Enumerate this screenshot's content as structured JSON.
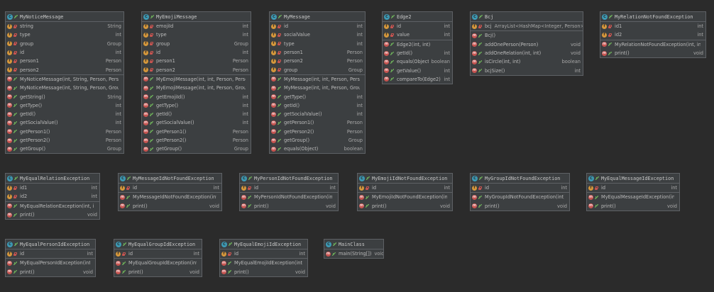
{
  "classes": [
    {
      "id": "MyNoticeMessage",
      "name": "MyNoticeMessage",
      "fields": [
        {
          "name": "string",
          "type": "String"
        },
        {
          "name": "type",
          "type": "int"
        },
        {
          "name": "group",
          "type": "Group"
        },
        {
          "name": "id",
          "type": "int"
        },
        {
          "name": "person1",
          "type": "Person"
        },
        {
          "name": "person2",
          "type": "Person"
        }
      ],
      "methods": [
        {
          "name": "MyNoticeMessage(int, String, Person, Person)",
          "type": ""
        },
        {
          "name": "MyNoticeMessage(int, String, Person, Group)",
          "type": ""
        },
        {
          "name": "getString()",
          "type": "String"
        },
        {
          "name": "getType()",
          "type": "int"
        },
        {
          "name": "getId()",
          "type": "int"
        },
        {
          "name": "getSocialValue()",
          "type": "int"
        },
        {
          "name": "getPerson1()",
          "type": "Person"
        },
        {
          "name": "getPerson2()",
          "type": "Person"
        },
        {
          "name": "getGroup()",
          "type": "Group"
        }
      ]
    },
    {
      "id": "MyEmojiMessage",
      "name": "MyEmojiMessage",
      "fields": [
        {
          "name": "emojiId",
          "type": "int"
        },
        {
          "name": "type",
          "type": "int"
        },
        {
          "name": "group",
          "type": "Group"
        },
        {
          "name": "id",
          "type": "int"
        },
        {
          "name": "person1",
          "type": "Person"
        },
        {
          "name": "person2",
          "type": "Person"
        }
      ],
      "methods": [
        {
          "name": "MyEmojiMessage(int, int, Person, Person)",
          "type": ""
        },
        {
          "name": "MyEmojiMessage(int, int, Person, Group)",
          "type": ""
        },
        {
          "name": "getEmojiId()",
          "type": "int"
        },
        {
          "name": "getType()",
          "type": "int"
        },
        {
          "name": "getId()",
          "type": "int"
        },
        {
          "name": "getSocialValue()",
          "type": "int"
        },
        {
          "name": "getPerson1()",
          "type": "Person"
        },
        {
          "name": "getPerson2()",
          "type": "Person"
        },
        {
          "name": "getGroup()",
          "type": "Group"
        }
      ]
    },
    {
      "id": "MyMessage",
      "name": "MyMessage",
      "fields": [
        {
          "name": "id",
          "type": "int"
        },
        {
          "name": "socialValue",
          "type": "int"
        },
        {
          "name": "type",
          "type": "int"
        },
        {
          "name": "person1",
          "type": "Person"
        },
        {
          "name": "person2",
          "type": "Person"
        },
        {
          "name": "group",
          "type": "Group"
        }
      ],
      "methods": [
        {
          "name": "MyMessage(int, int, Person, Person)",
          "type": ""
        },
        {
          "name": "MyMessage(int, int, Person, Group)",
          "type": ""
        },
        {
          "name": "getType()",
          "type": "int"
        },
        {
          "name": "getId()",
          "type": "int"
        },
        {
          "name": "getSocialValue()",
          "type": "int"
        },
        {
          "name": "getPerson1()",
          "type": "Person"
        },
        {
          "name": "getPerson2()",
          "type": "Person"
        },
        {
          "name": "getGroup()",
          "type": "Group"
        },
        {
          "name": "equals(Object)",
          "type": "boolean"
        }
      ]
    },
    {
      "id": "Edge2",
      "name": "Edge2",
      "fields": [
        {
          "name": "id",
          "type": "int"
        },
        {
          "name": "value",
          "type": "int"
        }
      ],
      "methods": [
        {
          "name": "Edge2(int, int)",
          "type": ""
        },
        {
          "name": "getId()",
          "type": "int"
        },
        {
          "name": "equals(Object)",
          "type": "boolean"
        },
        {
          "name": "getValue()",
          "type": "int"
        },
        {
          "name": "compareTo(Edge2)",
          "type": "int"
        }
      ]
    },
    {
      "id": "Bcj",
      "name": "Bcj",
      "fields": [
        {
          "name": "bcj",
          "type": "ArrayList<HashMap<Integer, Person>>",
          "inline": true
        }
      ],
      "methods": [
        {
          "name": "Bcj()",
          "type": ""
        },
        {
          "name": "addOnePerson(Person)",
          "type": "void"
        },
        {
          "name": "addOneRelation(int, int)",
          "type": "void"
        },
        {
          "name": "isCircle(int, int)",
          "type": "boolean"
        },
        {
          "name": "bcjSize()",
          "type": "int"
        }
      ]
    },
    {
      "id": "MyRelationNotFoundException",
      "name": "MyRelationNotFoundException",
      "fields": [
        {
          "name": "id1",
          "type": "int"
        },
        {
          "name": "id2",
          "type": "int"
        }
      ],
      "methods": [
        {
          "name": "MyRelationNotFoundException(int, int)",
          "type": ""
        },
        {
          "name": "print()",
          "type": "void"
        }
      ]
    },
    {
      "id": "MyEqualRelationException",
      "name": "MyEqualRelationException",
      "fields": [
        {
          "name": "id1",
          "type": "int"
        },
        {
          "name": "id2",
          "type": "int"
        }
      ],
      "methods": [
        {
          "name": "MyEqualRelationException(int, int)",
          "type": ""
        },
        {
          "name": "print()",
          "type": "void"
        }
      ]
    },
    {
      "id": "MyMessageIdNotFoundException",
      "name": "MyMessageIdNotFoundException",
      "fields": [
        {
          "name": "id",
          "type": "int"
        }
      ],
      "methods": [
        {
          "name": "MyMessageIdNotFoundException(int)",
          "type": ""
        },
        {
          "name": "print()",
          "type": "void"
        }
      ]
    },
    {
      "id": "MyPersonIdNotFoundException",
      "name": "MyPersonIdNotFoundException",
      "fields": [
        {
          "name": "id",
          "type": "int"
        }
      ],
      "methods": [
        {
          "name": "MyPersonIdNotFoundException(int)",
          "type": ""
        },
        {
          "name": "print()",
          "type": "void"
        }
      ]
    },
    {
      "id": "MyEmojiIdNotFoundException",
      "name": "MyEmojiIdNotFoundException",
      "fields": [
        {
          "name": "id",
          "type": "int"
        }
      ],
      "methods": [
        {
          "name": "MyEmojiIdNotFoundException(int)",
          "type": ""
        },
        {
          "name": "print()",
          "type": "void"
        }
      ]
    },
    {
      "id": "MyGroupIdNotFoundException",
      "name": "MyGroupIdNotFoundException",
      "fields": [
        {
          "name": "id",
          "type": "int"
        }
      ],
      "methods": [
        {
          "name": "MyGroupIdNotFoundException(int)",
          "type": ""
        },
        {
          "name": "print()",
          "type": "void"
        }
      ]
    },
    {
      "id": "MyEqualMessageIdException",
      "name": "MyEqualMessageIdException",
      "fields": [
        {
          "name": "id",
          "type": "int"
        }
      ],
      "methods": [
        {
          "name": "MyEqualMessageIdException(int)",
          "type": ""
        },
        {
          "name": "print()",
          "type": "void"
        }
      ]
    },
    {
      "id": "MyEqualPersonIdException",
      "name": "MyEqualPersonIdException",
      "fields": [
        {
          "name": "id",
          "type": "int"
        }
      ],
      "methods": [
        {
          "name": "MyEqualPersonIdException(int)",
          "type": ""
        },
        {
          "name": "print()",
          "type": "void"
        }
      ]
    },
    {
      "id": "MyEqualGroupIdException",
      "name": "MyEqualGroupIdException",
      "fields": [
        {
          "name": "id",
          "type": "int"
        }
      ],
      "methods": [
        {
          "name": "MyEqualGroupIdException(int)",
          "type": ""
        },
        {
          "name": "print()",
          "type": "void"
        }
      ]
    },
    {
      "id": "MyEqualEmojiIdException",
      "name": "MyEqualEmojiIdException",
      "fields": [
        {
          "name": "id",
          "type": "int"
        }
      ],
      "methods": [
        {
          "name": "MyEqualEmojiIdException(int)",
          "type": ""
        },
        {
          "name": "print()",
          "type": "void"
        }
      ]
    },
    {
      "id": "MainClass",
      "name": "MainClass",
      "fields": [],
      "methods": [
        {
          "name": "main(String[])",
          "type": "void",
          "static": true
        }
      ]
    }
  ]
}
